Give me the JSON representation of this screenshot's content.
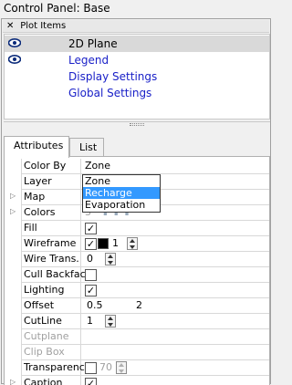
{
  "window": {
    "title": "Control Panel: Base"
  },
  "plot_items": {
    "header": "Plot Items",
    "collapse_glyph": "✕",
    "items": [
      {
        "label": "2D Plane",
        "visible_eye": true,
        "selected": true,
        "style": "normal"
      },
      {
        "label": "Legend",
        "visible_eye": true,
        "selected": false,
        "style": "link"
      },
      {
        "label": "Display Settings",
        "visible_eye": false,
        "selected": false,
        "style": "link"
      },
      {
        "label": "Global Settings",
        "visible_eye": false,
        "selected": false,
        "style": "link"
      }
    ]
  },
  "tabs": [
    {
      "label": "Attributes",
      "active": true
    },
    {
      "label": "List",
      "active": false
    }
  ],
  "properties": {
    "color_by": {
      "name": "Color By",
      "value": "Zone"
    },
    "layer": {
      "name": "Layer"
    },
    "map": {
      "name": "Map",
      "expandable": true
    },
    "colors": {
      "name": "Colors",
      "expandable": true,
      "value": "3"
    },
    "fill": {
      "name": "Fill",
      "checked": true
    },
    "wireframe": {
      "name": "Wireframe",
      "checked": true,
      "color": "#000000",
      "value": "1"
    },
    "wire_trans": {
      "name": "Wire Trans.",
      "value": "0"
    },
    "cull_backface": {
      "name": "Cull Backface",
      "checked": false
    },
    "lighting": {
      "name": "Lighting",
      "checked": true
    },
    "offset": {
      "name": "Offset",
      "value_a": "0.5",
      "value_b": "2"
    },
    "cutline": {
      "name": "CutLine",
      "value": "1"
    },
    "cutplane": {
      "name": "Cutplane",
      "disabled": true
    },
    "clip_box": {
      "name": "Clip Box",
      "disabled": true
    },
    "transparency": {
      "name": "Transparency",
      "checked": false,
      "value": "70"
    },
    "caption": {
      "name": "Caption",
      "expandable": true,
      "checked": true
    }
  },
  "color_by_dropdown": {
    "options": [
      "Zone",
      "Recharge",
      "Evaporation"
    ],
    "highlighted": "Recharge"
  },
  "colors": {
    "link": "#1a21c8",
    "selection": "#3399ff",
    "selected_row": "#d9d9d9"
  }
}
